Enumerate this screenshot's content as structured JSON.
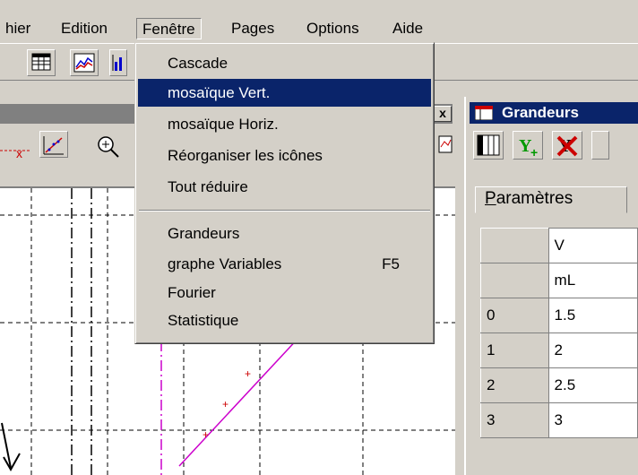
{
  "menubar": {
    "items": [
      "hier",
      "Edition",
      "Fenêtre",
      "Pages",
      "Options",
      "Aide"
    ]
  },
  "window_menu": {
    "items": [
      {
        "label": "Cascade",
        "key": ""
      },
      {
        "label": "mosaïque Vert.",
        "key": ""
      },
      {
        "label": "mosaïque Horiz.",
        "key": ""
      },
      {
        "label": "Réorganiser les icônes",
        "key": ""
      },
      {
        "label": "Tout réduire",
        "key": ""
      },
      {
        "label": "Grandeurs",
        "key": ""
      },
      {
        "label": "graphe Variables",
        "key": "F5"
      },
      {
        "label": "Fourier",
        "key": ""
      },
      {
        "label": "Statistique",
        "key": ""
      }
    ],
    "highlighted": "mosaïque Vert."
  },
  "left_window": {
    "close_label": "x"
  },
  "grandeurs_window": {
    "title": "Grandeurs",
    "tab_label_first": "P",
    "tab_label_rest": "aramètres",
    "table": {
      "header_name": "V",
      "header_unit": "mL",
      "rows": [
        {
          "index": "0",
          "value": "1.5"
        },
        {
          "index": "1",
          "value": "2"
        },
        {
          "index": "2",
          "value": "2.5"
        },
        {
          "index": "3",
          "value": "3"
        }
      ]
    }
  },
  "colors": {
    "menu_highlight": "#0a246a",
    "title_active": "#0a246a",
    "graph_line": "#cc00cc",
    "graph_points": "#cc0000"
  },
  "icons": [
    "table-icon",
    "line-chart-icon",
    "bar-chart-icon",
    "x-axis-icon",
    "trend-icon",
    "zoom-icon",
    "grandeurs-icon",
    "add-variable-icon",
    "delete-variable-icon"
  ]
}
